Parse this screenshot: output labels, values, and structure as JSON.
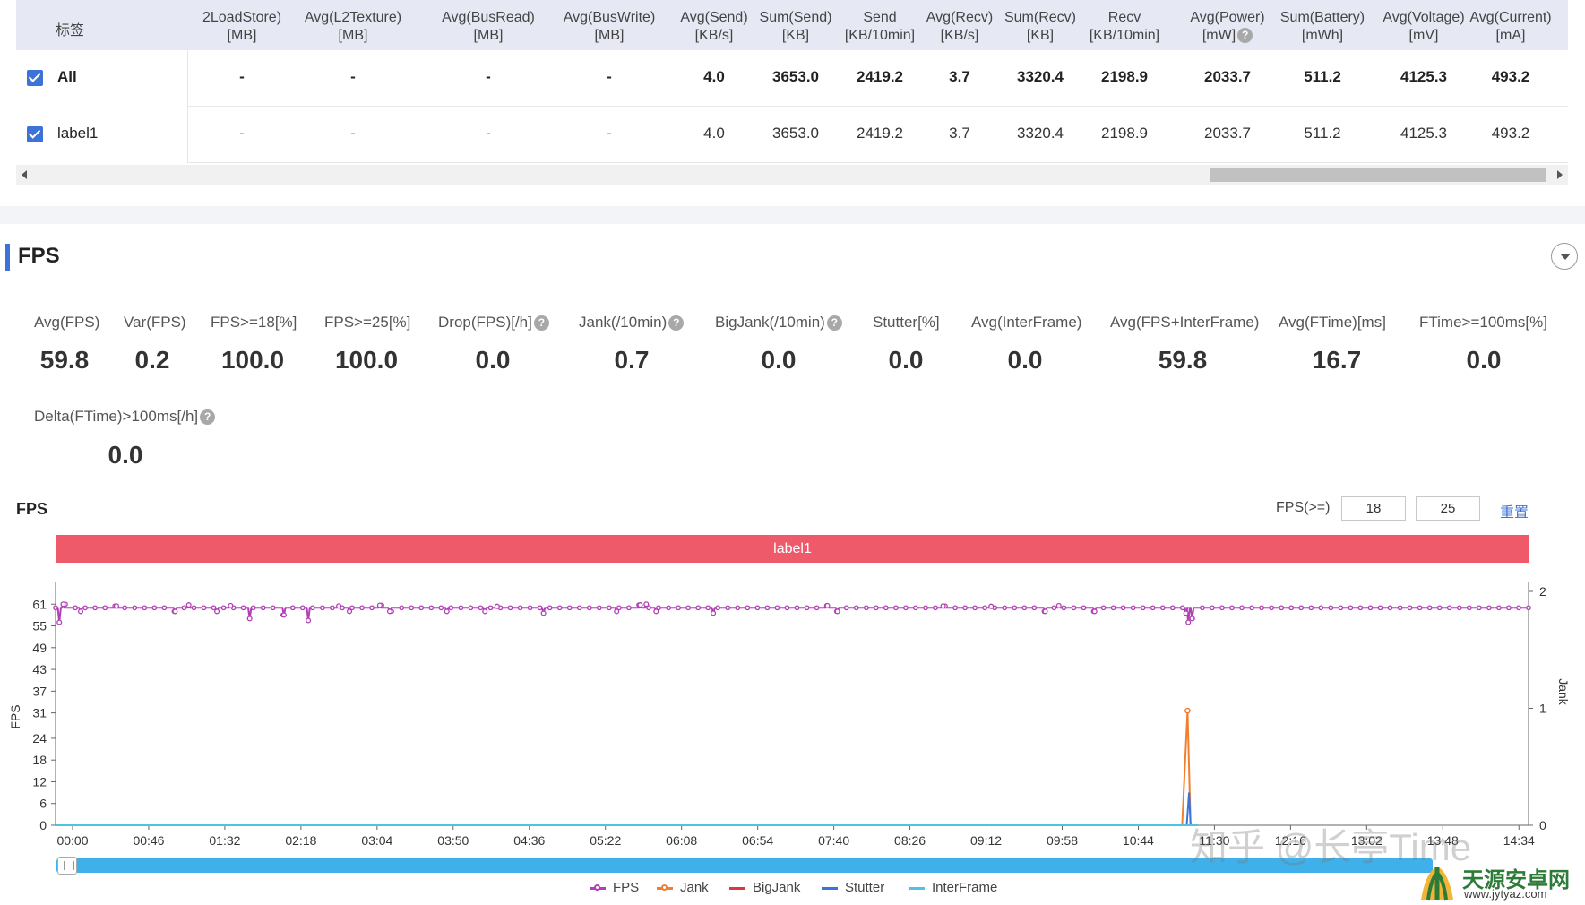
{
  "table": {
    "label_header": "标签",
    "columns": [
      {
        "l1": "2LoadStore)",
        "l2": "[MB]"
      },
      {
        "l1": "Avg(L2Texture)",
        "l2": "[MB]"
      },
      {
        "l1": "Avg(BusRead)",
        "l2": "[MB]"
      },
      {
        "l1": "Avg(BusWrite)",
        "l2": "[MB]"
      },
      {
        "l1": "Avg(Send)",
        "l2": "[KB/s]"
      },
      {
        "l1": "Sum(Send)",
        "l2": "[KB]"
      },
      {
        "l1": "Send",
        "l2": "[KB/10min]"
      },
      {
        "l1": "Avg(Recv)",
        "l2": "[KB/s]"
      },
      {
        "l1": "Sum(Recv)",
        "l2": "[KB]"
      },
      {
        "l1": "Recv",
        "l2": "[KB/10min]"
      },
      {
        "l1": "Avg(Power)",
        "l2": "[mW]"
      },
      {
        "l1": "Sum(Battery)",
        "l2": "[mWh]"
      },
      {
        "l1": "Avg(Voltage)",
        "l2": "[mV]"
      },
      {
        "l1": "Avg(Current)",
        "l2": "[mA]"
      }
    ],
    "rows": [
      {
        "name": "All",
        "checked": true,
        "cells": [
          "-",
          "-",
          "-",
          "-",
          "4.0",
          "3653.0",
          "2419.2",
          "3.7",
          "3320.4",
          "2198.9",
          "2033.7",
          "511.2",
          "4125.3",
          "493.2"
        ]
      },
      {
        "name": "label1",
        "checked": true,
        "cells": [
          "-",
          "-",
          "-",
          "-",
          "4.0",
          "3653.0",
          "2419.2",
          "3.7",
          "3320.4",
          "2198.9",
          "2033.7",
          "511.2",
          "4125.3",
          "493.2"
        ]
      }
    ]
  },
  "fps_section": {
    "title": "FPS",
    "help_glyph": "?",
    "metrics": [
      {
        "label": "Avg(FPS)",
        "value": "59.8"
      },
      {
        "label": "Var(FPS)",
        "value": "0.2"
      },
      {
        "label": "FPS>=18[%]",
        "value": "100.0"
      },
      {
        "label": "FPS>=25[%]",
        "value": "100.0"
      },
      {
        "label": "Drop(FPS)[/h]",
        "value": "0.0",
        "help": true
      },
      {
        "label": "Jank(/10min)",
        "value": "0.7",
        "help": true
      },
      {
        "label": "BigJank(/10min)",
        "value": "0.0",
        "help": true
      },
      {
        "label": "Stutter[%]",
        "value": "0.0"
      },
      {
        "label": "Avg(InterFrame)",
        "value": "0.0"
      },
      {
        "label": "Avg(FPS+InterFrame)",
        "value": "59.8"
      },
      {
        "label": "Avg(FTime)[ms]",
        "value": "16.7"
      },
      {
        "label": "FTime>=100ms[%]",
        "value": "0.0"
      },
      {
        "label": "Delta(FTime)>100ms[/h]",
        "value": "0.0",
        "help": true
      }
    ]
  },
  "chart_header": {
    "title": "FPS",
    "fps_ge_label": "FPS(>=)",
    "threshold_1": "18",
    "threshold_2": "25",
    "reset_label": "重置",
    "band_label": "label1"
  },
  "chart_data": {
    "type": "line",
    "ylabel": "FPS",
    "y2label": "Jank",
    "y_ticks": [
      0,
      6,
      12,
      18,
      24,
      31,
      37,
      43,
      49,
      55,
      61
    ],
    "ylim": [
      0,
      67
    ],
    "y2_ticks": [
      0,
      1,
      2
    ],
    "y2lim": [
      0,
      2
    ],
    "x_ticks": [
      "00:00",
      "00:46",
      "01:32",
      "02:18",
      "03:04",
      "03:50",
      "04:36",
      "05:22",
      "06:08",
      "06:54",
      "07:40",
      "08:26",
      "09:12",
      "09:58",
      "10:44",
      "11:30",
      "12:16",
      "13:02",
      "13:48",
      "14:34"
    ],
    "grid": false,
    "legend_position": "bottom",
    "series": [
      {
        "name": "FPS",
        "color": "#b23fb5",
        "axis": "left",
        "baseline": 60,
        "dips": [
          [
            0.05,
            56
          ],
          [
            0.33,
            59
          ],
          [
            1.57,
            59
          ],
          [
            2.12,
            59
          ],
          [
            2.55,
            57
          ],
          [
            3.0,
            58
          ],
          [
            3.32,
            56.5
          ],
          [
            3.86,
            59
          ],
          [
            4.39,
            59
          ],
          [
            5.14,
            59
          ],
          [
            5.64,
            59
          ],
          [
            6.41,
            58.5
          ],
          [
            7.37,
            59
          ],
          [
            7.89,
            59
          ],
          [
            8.64,
            58.5
          ],
          [
            10.27,
            59
          ],
          [
            13.0,
            59
          ],
          [
            13.65,
            59
          ],
          [
            14.85,
            58.5
          ],
          [
            14.88,
            56
          ],
          [
            14.93,
            57
          ]
        ],
        "peaks": [
          [
            0.1,
            61
          ],
          [
            0.8,
            60.5
          ],
          [
            1.75,
            60.8
          ],
          [
            2.3,
            60.6
          ],
          [
            3.72,
            60.5
          ],
          [
            4.26,
            60.7
          ],
          [
            5.8,
            60.4
          ],
          [
            7.68,
            60.8
          ],
          [
            7.76,
            61
          ],
          [
            10.14,
            60.6
          ],
          [
            11.66,
            60.5
          ],
          [
            12.29,
            60.4
          ],
          [
            13.18,
            60.6
          ]
        ]
      },
      {
        "name": "Jank",
        "color": "#f08030",
        "axis": "right",
        "points": [
          [
            0.0,
            0
          ],
          [
            14.8,
            0
          ],
          [
            14.87,
            0.98
          ],
          [
            14.91,
            0
          ],
          [
            15.0,
            0
          ]
        ]
      },
      {
        "name": "BigJank",
        "color": "#d9393a",
        "axis": "right",
        "points": [
          [
            0.0,
            0
          ],
          [
            15.0,
            0
          ]
        ]
      },
      {
        "name": "Stutter",
        "color": "#3d73d9",
        "axis": "right",
        "points": [
          [
            0.0,
            0
          ],
          [
            14.86,
            0
          ],
          [
            14.89,
            0.28
          ],
          [
            14.91,
            0
          ],
          [
            15.0,
            0
          ]
        ]
      },
      {
        "name": "InterFrame",
        "color": "#4fc4e0",
        "axis": "right",
        "points": [
          [
            0.0,
            0
          ],
          [
            15.0,
            0
          ]
        ]
      }
    ]
  },
  "legend": [
    {
      "name": "FPS",
      "color": "#b23fb5",
      "dot": true
    },
    {
      "name": "Jank",
      "color": "#f08030",
      "dot": true
    },
    {
      "name": "BigJank",
      "color": "#d9393a",
      "dot": false
    },
    {
      "name": "Stutter",
      "color": "#3d73d9",
      "dot": false
    },
    {
      "name": "InterFrame",
      "color": "#4fc4e0",
      "dot": false
    }
  ],
  "watermark": {
    "left_text": "知乎 @长亭Time",
    "right_text": "天源安卓网",
    "right_url": "www.jytyaz.com"
  }
}
